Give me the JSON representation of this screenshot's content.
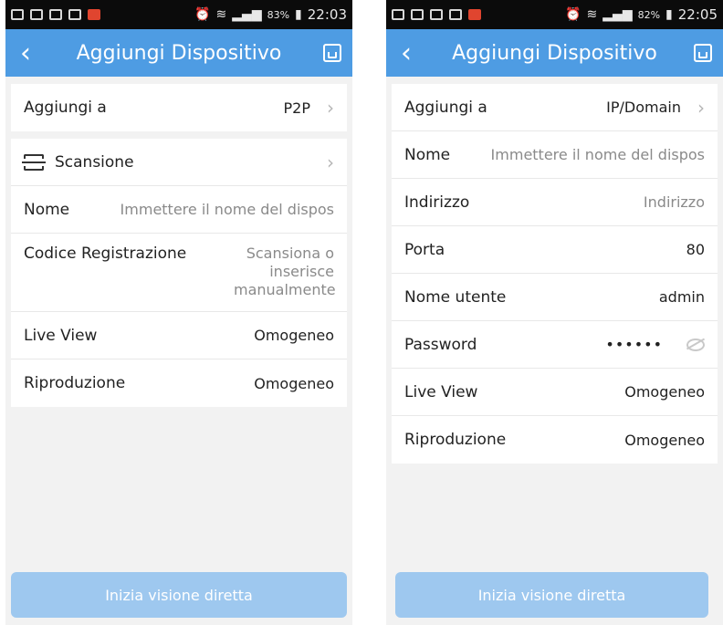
{
  "left": {
    "status": {
      "battery": "83%",
      "time": "22:03"
    },
    "header": {
      "title": "Aggiungi Dispositivo"
    },
    "rows": {
      "add_to_label": "Aggiungi a",
      "add_to_value": "P2P",
      "scan_label": "Scansione",
      "name_label": "Nome",
      "name_placeholder": "Immettere il nome del dispos",
      "reg_label": "Codice Registrazione",
      "reg_line1": "Scansiona o",
      "reg_line2": "inserisce",
      "reg_line3": "manualmente",
      "live_label": "Live View",
      "live_value": "Omogeneo",
      "play_label": "Riproduzione",
      "play_value": "Omogeneo"
    },
    "button": "Inizia visione diretta"
  },
  "right": {
    "status": {
      "battery": "82%",
      "time": "22:05"
    },
    "header": {
      "title": "Aggiungi Dispositivo"
    },
    "rows": {
      "add_to_label": "Aggiungi a",
      "add_to_value": "IP/Domain",
      "name_label": "Nome",
      "name_placeholder": "Immettere il nome del dispos",
      "addr_label": "Indirizzo",
      "addr_placeholder": "Indirizzo",
      "port_label": "Porta",
      "port_value": "80",
      "user_label": "Nome utente",
      "user_value": "admin",
      "pw_label": "Password",
      "pw_value": "••••••",
      "live_label": "Live View",
      "live_value": "Omogeneo",
      "play_label": "Riproduzione",
      "play_value": "Omogeneo"
    },
    "button": "Inizia visione diretta"
  },
  "icons": [
    "back-chevron-icon",
    "save-icon",
    "scan-icon",
    "chevron-right-icon",
    "eye-icon"
  ],
  "colors": {
    "header": "#4e9ce3",
    "button": "#9ec8ef",
    "background": "#f2f2f2"
  }
}
